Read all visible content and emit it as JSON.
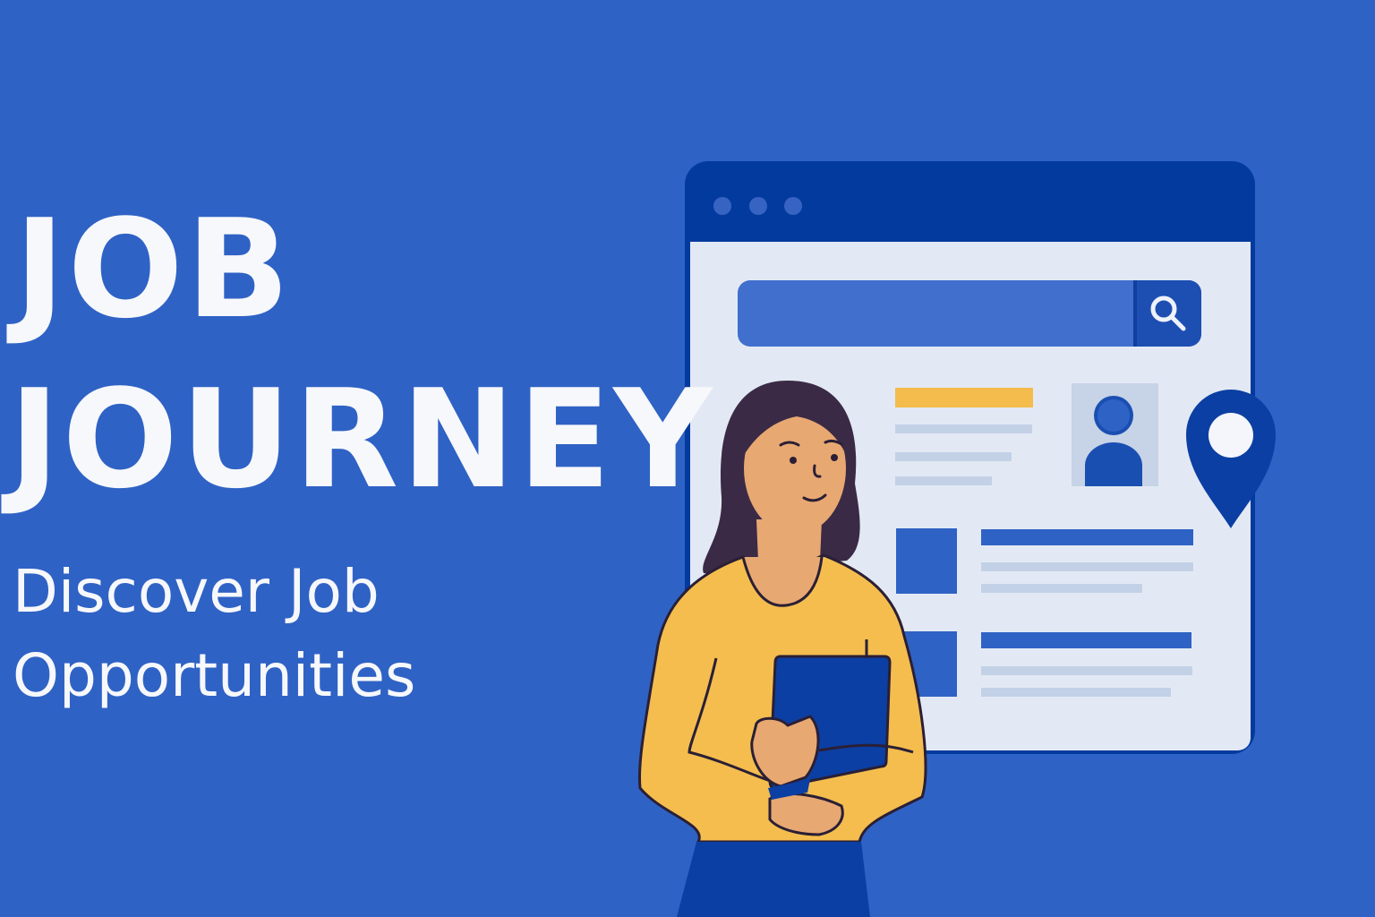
{
  "headline": {
    "line1": "JOB",
    "line2": "JOURNEY"
  },
  "tagline": {
    "line1": "Discover Job",
    "line2": "Opportunities"
  },
  "colors": {
    "background": "#2f62c5",
    "window_chrome": "#033a9e",
    "window_body": "#e3e9f4",
    "accent_yellow": "#f3bc4d",
    "placeholder_line": "#c3d1e7",
    "person_skin": "#e8a872",
    "person_hair": "#3a2a45",
    "pin_blue": "#0c3fa3"
  },
  "icons": {
    "search": "magnifier-icon",
    "profile": "user-silhouette-icon",
    "location": "map-pin-icon"
  }
}
